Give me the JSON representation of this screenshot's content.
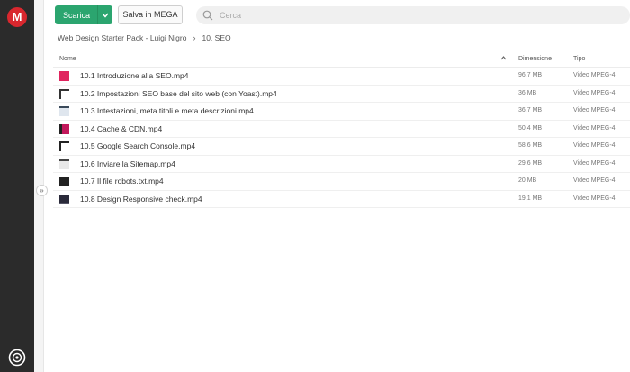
{
  "app": {
    "logo_letter": "M"
  },
  "toolbar": {
    "download_label": "Scarica",
    "save_label": "Salva in MEGA"
  },
  "search": {
    "placeholder": "Cerca"
  },
  "breadcrumb": {
    "parent": "Web Design Starter Pack - Luigi Nigro",
    "separator": "›",
    "current": "10. SEO"
  },
  "table": {
    "headers": {
      "name": "Nome",
      "size": "Dimensione",
      "type": "Tipo"
    },
    "rows": [
      {
        "name": "10.1 Introduzione alla SEO.mp4",
        "size": "96,7 MB",
        "type": "Video MPEG-4",
        "thumb_color": "#e0245e"
      },
      {
        "name": "10.2 Impostazioni SEO base del sito web (con Yoast).mp4",
        "size": "36 MB",
        "type": "Video MPEG-4",
        "thumb_color": "#ffffff"
      },
      {
        "name": "10.3 Intestazioni, meta titoli e meta descrizioni.mp4",
        "size": "36,7 MB",
        "type": "Video MPEG-4",
        "thumb_color": "#dfe6ee"
      },
      {
        "name": "10.4 Cache & CDN.mp4",
        "size": "50,4 MB",
        "type": "Video MPEG-4",
        "thumb_color": "#c2185b"
      },
      {
        "name": "10.5 Google Search Console.mp4",
        "size": "58,6 MB",
        "type": "Video MPEG-4",
        "thumb_color": "#ffffff"
      },
      {
        "name": "10.6 Inviare la Sitemap.mp4",
        "size": "29,6 MB",
        "type": "Video MPEG-4",
        "thumb_color": "#e8e8e8"
      },
      {
        "name": "10.7 Il file robots.txt.mp4",
        "size": "20 MB",
        "type": "Video MPEG-4",
        "thumb_color": "#222222"
      },
      {
        "name": "10.8 Design Responsive check.mp4",
        "size": "19,1 MB",
        "type": "Video MPEG-4",
        "thumb_color": "#2a2a3a"
      }
    ]
  },
  "colors": {
    "accent_green": "#2ba56f",
    "brand_red": "#d9272e",
    "rail_dark": "#2b2b2b"
  }
}
